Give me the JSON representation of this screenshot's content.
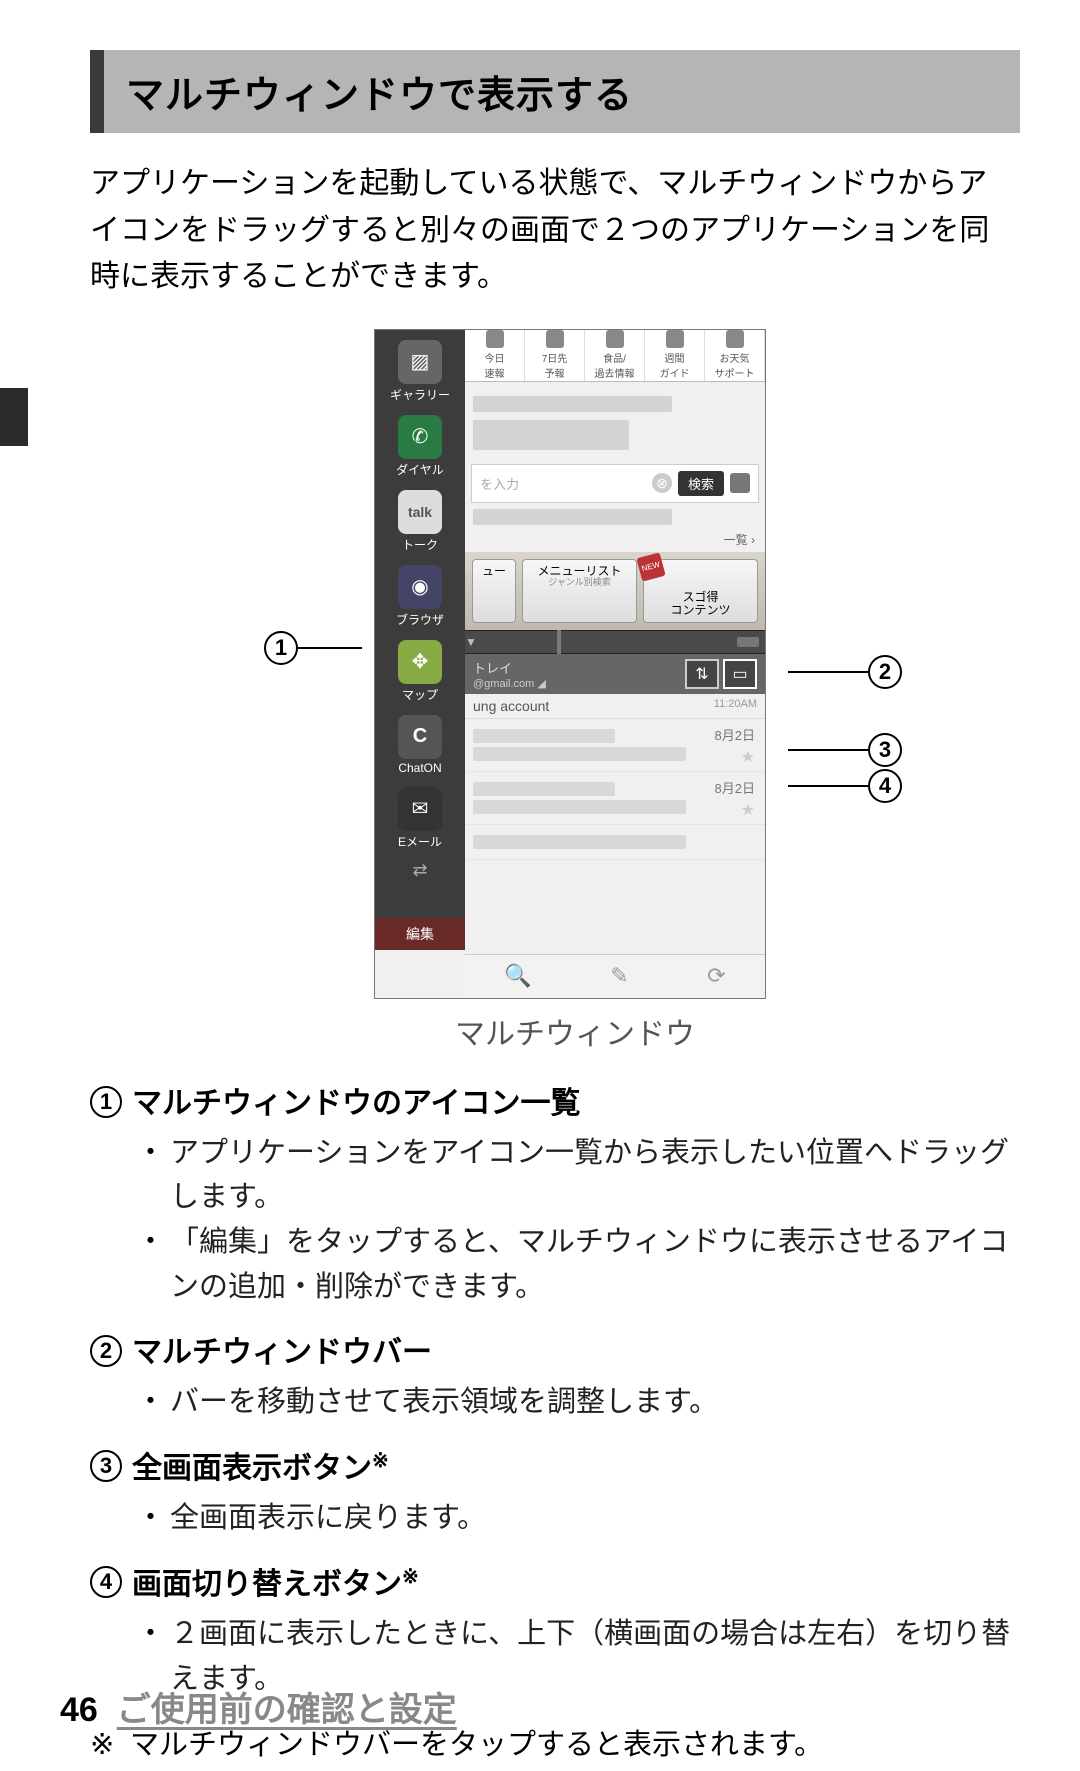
{
  "header": {
    "title": "マルチウィンドウで表示する"
  },
  "intro": "アプリケーションを起動している状態で、マルチウィンドウからアイコンをドラッグすると別々の画面で２つのアプリケーションを同時に表示することができます。",
  "figure": {
    "caption": "マルチウィンドウ",
    "sidebar_apps": [
      {
        "label": "ギャラリー",
        "glyph": "▨"
      },
      {
        "label": "ダイヤル",
        "glyph": "✆"
      },
      {
        "label": "トーク",
        "glyph": "talk"
      },
      {
        "label": "ブラウザ",
        "glyph": "◉"
      },
      {
        "label": "マップ",
        "glyph": "✥"
      },
      {
        "label": "ChatON",
        "glyph": "C"
      },
      {
        "label": "Eメール",
        "glyph": "✉"
      }
    ],
    "sidebar_edit": "編集",
    "top_tabs": [
      "今日\n速報",
      "7日先\n予報",
      "食品/\n過去情報",
      "週間\nガイド",
      "お天気\nサポート"
    ],
    "search": {
      "placeholder": "を入力",
      "clear": "⊗",
      "button": "検索"
    },
    "ichiran": "一覧 ›",
    "menu_row": {
      "menu_list": "メニューリスト",
      "menu_list_sub": "ジャンル別検索",
      "sugo": "スゴ得\nコンテンツ",
      "new": "NEW"
    },
    "mail": {
      "tray": "トレイ",
      "address": "@gmail.com ◢",
      "account": "ung account",
      "account_time": "11:20AM",
      "dates": [
        "8月2日",
        "8月2日"
      ]
    },
    "bottom_icons": [
      "🔍",
      "✎",
      "⟳"
    ],
    "callouts": {
      "1": "1",
      "2": "2",
      "3": "3",
      "4": "4"
    }
  },
  "items": [
    {
      "num": "1",
      "title": "マルチウィンドウのアイコン一覧",
      "bullets": [
        "アプリケーションをアイコン一覧から表示したい位置へドラッグします。",
        "「編集」をタップすると、マルチウィンドウに表示させるアイコンの追加・削除ができます。"
      ]
    },
    {
      "num": "2",
      "title": "マルチウィンドウバー",
      "bullets": [
        "バーを移動させて表示領域を調整します。"
      ]
    },
    {
      "num": "3",
      "title": "全画面表示ボタン",
      "title_sup": "※",
      "bullets": [
        "全画面表示に戻ります。"
      ]
    },
    {
      "num": "4",
      "title": "画面切り替えボタン",
      "title_sup": "※",
      "bullets": [
        "２画面に表示したときに、上下（横画面の場合は左右）を切り替えます。"
      ]
    }
  ],
  "note": {
    "mark": "※",
    "text": "マルチウィンドウバーをタップすると表示されます。"
  },
  "footer": {
    "page": "46",
    "section": "ご使用前の確認と設定"
  }
}
